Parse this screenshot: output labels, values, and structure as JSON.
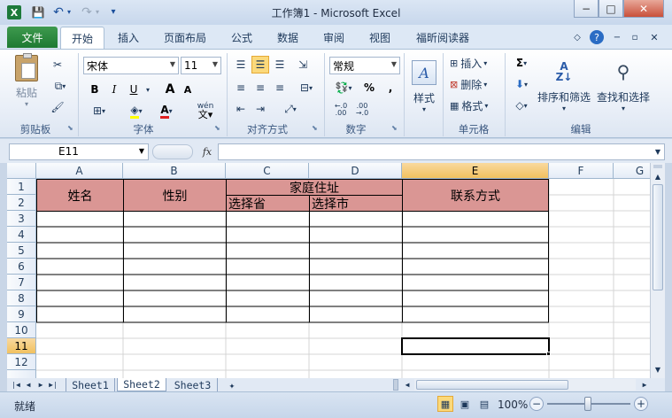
{
  "title": "工作簿1 - Microsoft Excel",
  "qat": {
    "save": "💾",
    "undo": "↶",
    "redo": "↷",
    "more": "▾"
  },
  "window_controls": {
    "minimize": "−",
    "maximize": "□",
    "close": "✕"
  },
  "tabs": [
    "文件",
    "开始",
    "插入",
    "页面布局",
    "公式",
    "数据",
    "审阅",
    "视图",
    "福昕阅读器"
  ],
  "ribbon": {
    "clipboard": {
      "label": "剪贴板",
      "paste": "粘贴"
    },
    "font": {
      "label": "字体",
      "name": "宋体",
      "size": "11",
      "bold": "B",
      "italic": "I",
      "underline": "U",
      "grow": "A",
      "shrink": "A",
      "font_color": "A",
      "phonetic": "wén"
    },
    "alignment": {
      "label": "对齐方式"
    },
    "number": {
      "label": "数字",
      "format": "常规",
      "percent": "%",
      "comma": ","
    },
    "styles": {
      "label": "样式"
    },
    "cells": {
      "label": "单元格",
      "insert": "插入",
      "delete": "删除",
      "format": "格式"
    },
    "editing": {
      "label": "编辑",
      "sum": "Σ",
      "sort": "排序和筛选",
      "find": "查找和选择"
    }
  },
  "formula_bar": {
    "name_box": "E11",
    "fx": "fx",
    "formula": ""
  },
  "columns": [
    "A",
    "B",
    "C",
    "D",
    "E",
    "F",
    "G"
  ],
  "rows": [
    "1",
    "2",
    "3",
    "4",
    "5",
    "6",
    "7",
    "8",
    "9",
    "10",
    "11",
    "12"
  ],
  "selected_cell": "E11",
  "table": {
    "name": "姓名",
    "gender": "性别",
    "address": "家庭住址",
    "province": "选择省",
    "city": "选择市",
    "contact": "联系方式"
  },
  "header_fill": "#da9694",
  "sheets": [
    "Sheet1",
    "Sheet2",
    "Sheet3"
  ],
  "active_sheet": "Sheet2",
  "status": {
    "ready": "就绪",
    "zoom": "100%"
  }
}
